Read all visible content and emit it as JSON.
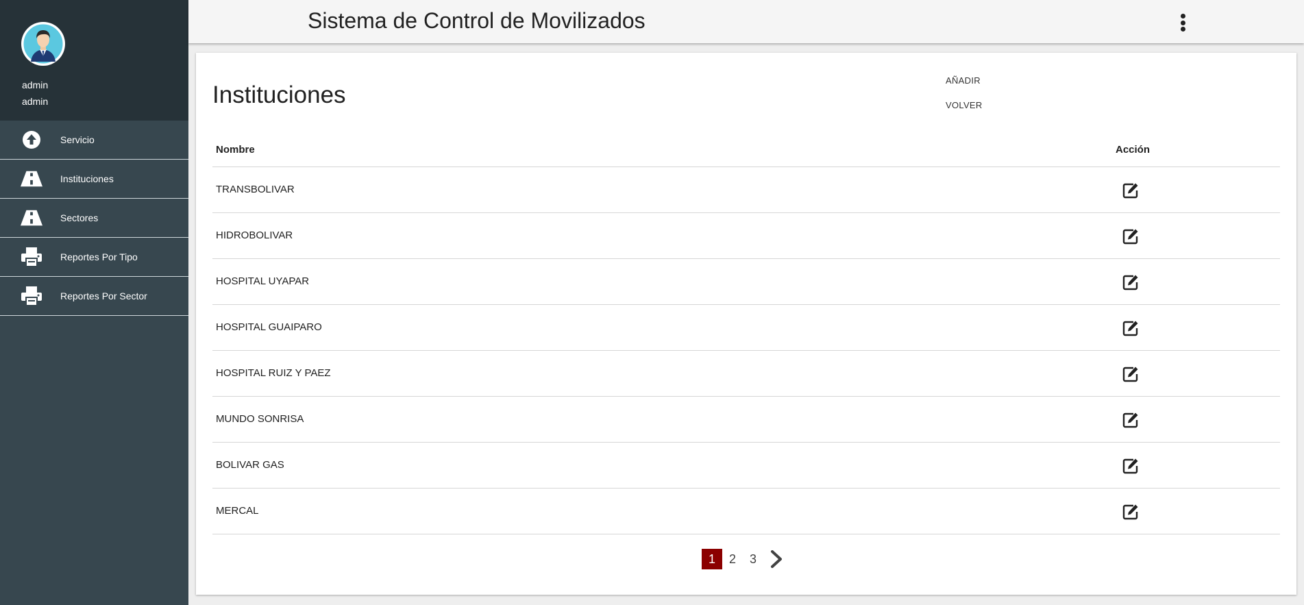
{
  "app": {
    "title": "Sistema de Control de Movilizados"
  },
  "user": {
    "name": "admin",
    "role": "admin"
  },
  "sidebar": {
    "items": [
      {
        "label": "Servicio",
        "icon": "arrow-up-circle-icon"
      },
      {
        "label": "Instituciones",
        "icon": "road-icon"
      },
      {
        "label": "Sectores",
        "icon": "road-icon"
      },
      {
        "label": "Reportes Por Tipo",
        "icon": "printer-icon"
      },
      {
        "label": "Reportes Por Sector",
        "icon": "printer-icon"
      }
    ]
  },
  "page": {
    "title": "Instituciones",
    "add_label": "AÑADIR",
    "back_label": "VOLVER"
  },
  "table": {
    "columns": [
      "Nombre",
      "Acción"
    ],
    "rows": [
      "TRANSBOLIVAR",
      "HIDROBOLIVAR",
      "HOSPITAL UYAPAR",
      "HOSPITAL GUAIPARO",
      "HOSPITAL RUIZ Y PAEZ",
      "MUNDO SONRISA",
      "BOLIVAR GAS",
      "MERCAL"
    ]
  },
  "pagination": {
    "pages": [
      "1",
      "2",
      "3"
    ],
    "current": "1"
  },
  "colors": {
    "sidebar_bg": "#37474f",
    "sidebar_header_bg": "#263238",
    "active_page": "#8b0000"
  }
}
